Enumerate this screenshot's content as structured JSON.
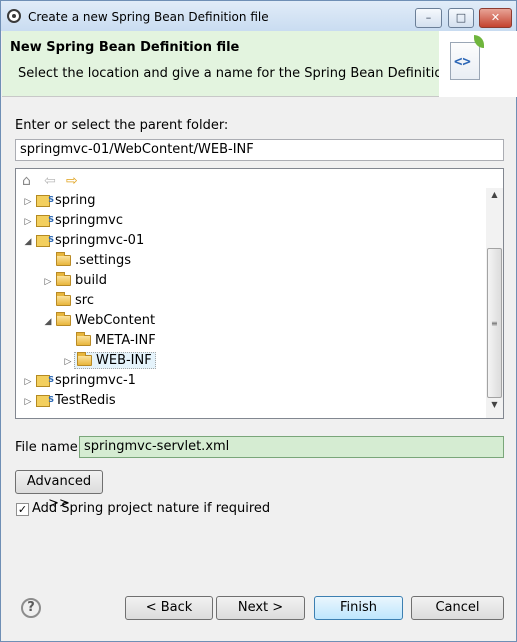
{
  "window": {
    "title": "Create a new Spring Bean Definition file",
    "minimize": "–",
    "maximize": "□",
    "close": "✕"
  },
  "header": {
    "title": "New Spring Bean Definition file",
    "description": "Select the location and give a name for the Spring Bean Definition file",
    "wizard_icon_glyph": "<>"
  },
  "parent_folder": {
    "label": "Enter or select the parent folder:",
    "value": "springmvc-01/WebContent/WEB-INF"
  },
  "tree_toolbar": {
    "home": "⌂",
    "back": "⇦",
    "forward": "⇨"
  },
  "tree": [
    {
      "label": "spring",
      "twisty": "▷",
      "icon": "project-icon"
    },
    {
      "label": "springmvc",
      "twisty": "▷",
      "icon": "project-icon"
    },
    {
      "label": "springmvc-01",
      "twisty": "◢",
      "icon": "project-icon"
    },
    {
      "label": ".settings",
      "twisty": "",
      "icon": "folder-icon"
    },
    {
      "label": "build",
      "twisty": "▷",
      "icon": "folder-icon"
    },
    {
      "label": "src",
      "twisty": "",
      "icon": "folder-icon"
    },
    {
      "label": "WebContent",
      "twisty": "◢",
      "icon": "folder-icon"
    },
    {
      "label": "META-INF",
      "twisty": "",
      "icon": "folder-icon"
    },
    {
      "label": "WEB-INF",
      "twisty": "▷",
      "icon": "folder-icon",
      "selected": true
    },
    {
      "label": "springmvc-1",
      "twisty": "▷",
      "icon": "project-icon"
    },
    {
      "label": "TestRedis",
      "twisty": "▷",
      "icon": "project-icon"
    }
  ],
  "scrollbar": {
    "up": "▲",
    "down": "▼",
    "grip": "≡"
  },
  "file_name": {
    "label": "File name:",
    "value": "springmvc-servlet.xml"
  },
  "advanced_button": "Advanced >>",
  "checkbox": {
    "label": "Add Spring project nature if required",
    "checked": true,
    "mark": "✓"
  },
  "footer": {
    "help": "?",
    "back": "< Back",
    "next": "Next >",
    "finish": "Finish",
    "cancel": "Cancel"
  }
}
